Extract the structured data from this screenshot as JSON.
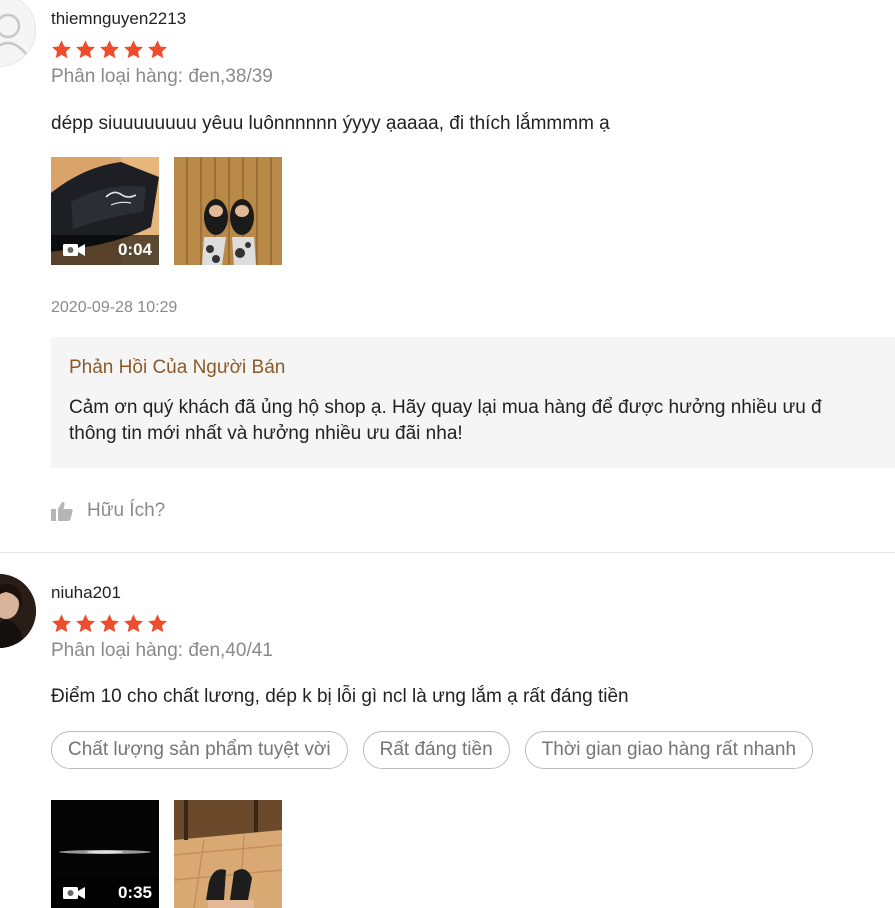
{
  "reviews": [
    {
      "username": "thiemnguyen2213",
      "rating": 5,
      "variation": "Phân loại hàng: đen,38/39",
      "comment": "dépp siuuuuuuuu yêuu luônnnnnn ýyyy ạaaaa, đi thích lắmmmm ạ",
      "video_duration": "0:04",
      "timestamp": "2020-09-28 10:29",
      "seller_reply": {
        "title": "Phản Hồi Của Người Bán",
        "line1": "Cảm ơn quý khách đã ủng hộ shop ạ. Hãy quay lại mua hàng để được hưởng nhiều ưu đ",
        "line2": "thông tin mới nhất và hưởng nhiều ưu đãi nha!"
      },
      "helpful_label": "Hữu Ích?"
    },
    {
      "username": "niuha201",
      "rating": 5,
      "variation": "Phân loại hàng: đen,40/41",
      "comment": "Điểm 10 cho chất lương, dép k bị lỗi gì ncl là ưng lắm ạ rất đáng tiền",
      "tags": [
        "Chất lượng sản phẩm tuyệt vời",
        "Rất đáng tiền",
        "Thời gian giao hàng rất nhanh"
      ],
      "video_duration": "0:35"
    }
  ],
  "colors": {
    "star": "#ee4d2d",
    "reply_title": "#8b5a2b",
    "muted": "#8a8a8a"
  },
  "icons": {
    "star": "star-icon",
    "video": "video-camera-icon",
    "thumbs_up": "thumbs-up-icon",
    "user": "user-icon"
  }
}
